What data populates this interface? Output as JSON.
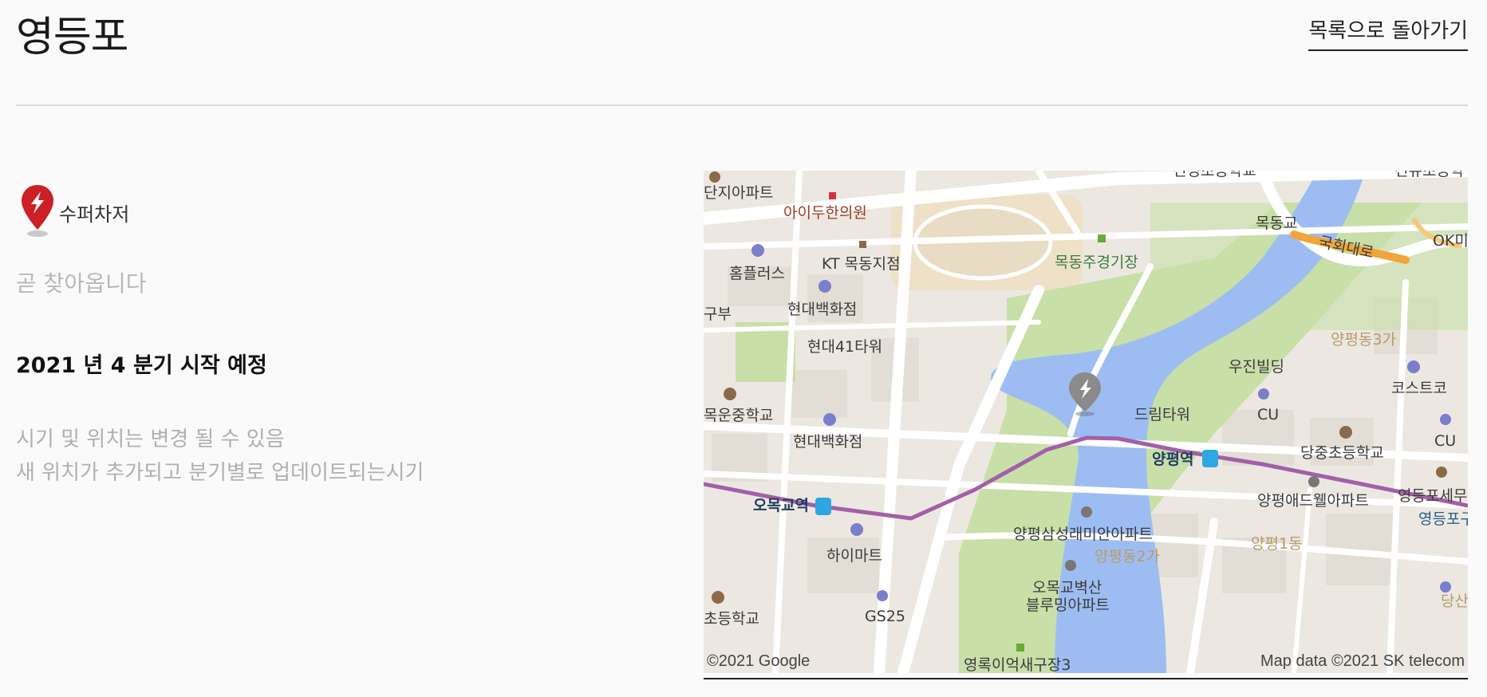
{
  "header": {
    "title": "영등포",
    "back_link": "목록으로 돌아가기"
  },
  "station": {
    "charger_type": "수퍼차저",
    "status": "곧 찾아옵니다",
    "schedule": "2021 년 4 분기 시작 예정",
    "notes": [
      "시기 및 위치는 변경 될 수 있음",
      "새 위치가 추가되고 분기별로 업데이트되는시기"
    ]
  },
  "map": {
    "labels": {
      "l1": "단지아파트",
      "l2": "아이두한의원",
      "l3": "KT 목동지점",
      "l4": "홈플러스",
      "l5": "현대백화점",
      "l6": "현대41타워",
      "l7": "목동주경기장",
      "l8": "목동교",
      "l9": "국회대로",
      "l10": "OK미",
      "l11": "양평동3가",
      "l12": "우진빌딩",
      "l13": "코스트코",
      "l14": "드림타워",
      "l15": "CU",
      "l16": "CU",
      "l17": "양평역",
      "l18": "당중초등학교",
      "l19": "목운중학교",
      "l20": "현대백화점",
      "l21": "오목교역",
      "l22": "양평애드웰아파트",
      "l23": "영등포세무",
      "l24": "영등포구",
      "l25": "양평삼성래미안아파트",
      "l26": "양평동2가",
      "l27": "양평1동",
      "l28": "하이마트",
      "l29": "오목교벽산",
      "l30": "블루밍아파트",
      "l31": "GS25",
      "l32": "초등학교",
      "l33": "당산",
      "l34": "영록이억새구장3",
      "l35": "구부",
      "l36": "신정초등학교",
      "l37": "선유초등학"
    },
    "copyright_left": "©2021 Google",
    "copyright_right": "Map data ©2021 SK telecom",
    "colors": {
      "river": "#9dbdf2",
      "park": "#c8dfa8",
      "road": "#ffffff",
      "subway_line": "#a35fa8",
      "highway": "#f2a53a",
      "charger_pin": "#cc1f26",
      "map_pin": "#8a8a8a"
    }
  }
}
